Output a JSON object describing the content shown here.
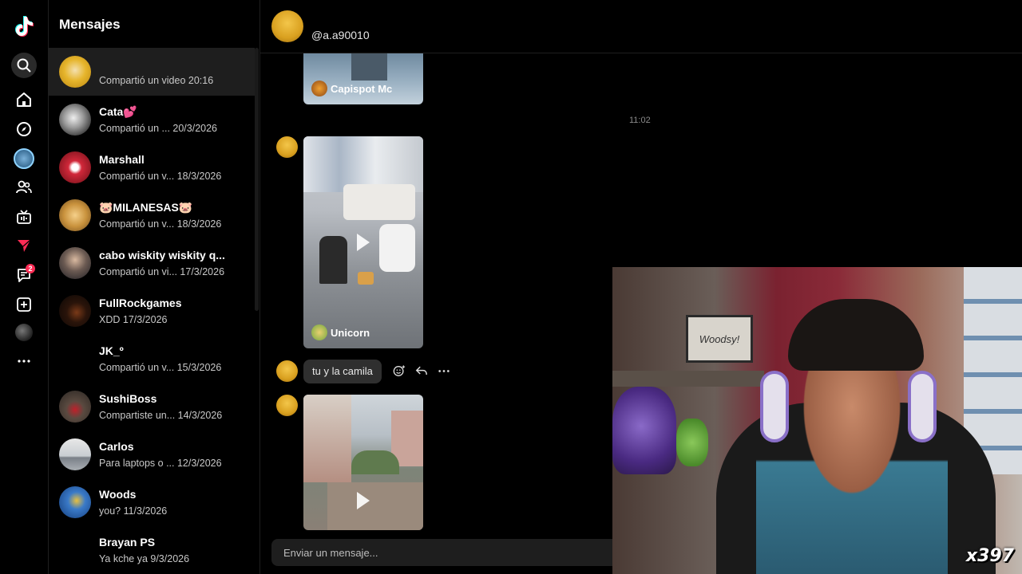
{
  "sidebar": {
    "logo": "tiktok-logo",
    "icons": [
      "search-icon",
      "home-icon",
      "explore-icon",
      "following-avatar",
      "friends-icon",
      "live-icon",
      "messages-send-icon",
      "inbox-icon",
      "upload-icon",
      "profile-avatar",
      "more-icon"
    ],
    "inbox_badge": "2"
  },
  "conversations": {
    "title": "Mensajes",
    "items": [
      {
        "name": "",
        "preview": "Compartió un video 20:16"
      },
      {
        "name": "Cata💕",
        "preview": "Compartió un ... 20/3/2026"
      },
      {
        "name": "Marshall",
        "preview": "Compartió un v... 18/3/2026"
      },
      {
        "name": "🐷MILANESAS🐷",
        "preview": "Compartió un v... 18/3/2026"
      },
      {
        "name": "cabo wiskity wiskity q...",
        "preview": "Compartió un vi... 17/3/2026"
      },
      {
        "name": "FullRockgames",
        "preview": "XDD 17/3/2026"
      },
      {
        "name": "JK_º",
        "preview": "Compartió un v... 15/3/2026"
      },
      {
        "name": "SushiBoss",
        "preview": "Compartiste un... 14/3/2026"
      },
      {
        "name": "Carlos",
        "preview": "Para laptops o ... 12/3/2026"
      },
      {
        "name": "Woods",
        "preview": "you? 11/3/2026"
      },
      {
        "name": "Brayan PS",
        "preview": "Ya kche ya 9/3/2026"
      }
    ]
  },
  "chat": {
    "handle": "@a.a90010",
    "messages": {
      "video1_label": "Capispot Mc",
      "timestamp": "11:02",
      "video2_label": "Unicorn",
      "text_message": "tu y la camila"
    },
    "input_placeholder": "Enviar un mensaje..."
  },
  "webcam": {
    "sign_text": "Woodsy!",
    "overlay_label": "x397"
  },
  "colors": {
    "background": "#000000",
    "selected_row": "#1e1e1e",
    "accent": "#fe2c55",
    "bubble": "#2f2f2f"
  }
}
